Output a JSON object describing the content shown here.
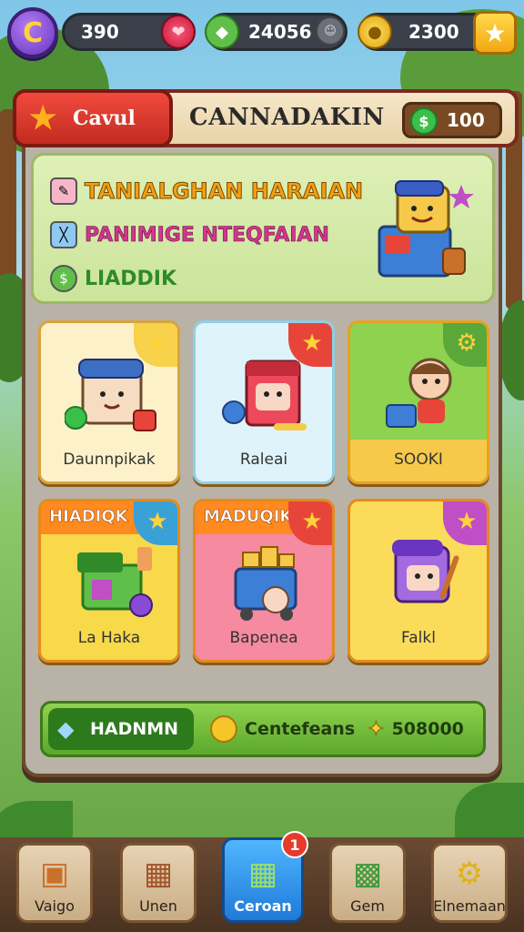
{
  "hud": {
    "avatar_glyph": "C",
    "lives_value": "390",
    "gems_value": "24056",
    "coins_value": "2300",
    "lives_icon": "heart-icon",
    "gems_icon": "gem-icon",
    "coins_icon": "coin-stack-icon",
    "star_icon": "star-icon"
  },
  "panel": {
    "ribbon_label": "Cavul",
    "title": "CANNADAKIN",
    "coin_value": "100",
    "coin_icon": "dollar-coin-icon"
  },
  "tasks": [
    {
      "label": "TANIALGHAN HARAIAN",
      "icon": "pencil-icon",
      "color": "#f2a012"
    },
    {
      "label": "PANIMIGE NTEQFAIAN",
      "icon": "ruler-icon",
      "color": "#d43590"
    },
    {
      "label": "LIADDIK",
      "icon": "dollar-coin-icon",
      "color": "#2f8a2a"
    }
  ],
  "cards": [
    {
      "label": "Daunnpikak",
      "header": "",
      "bg": "#fdf1c9",
      "tag_color": "#f7d24a",
      "tag_icon": "star-icon",
      "border": "#d9a43a"
    },
    {
      "label": "Raleai",
      "header": "",
      "bg": "#dff3fb",
      "tag_color": "#e8453a",
      "tag_icon": "star-icon",
      "border": "#8fcfe6"
    },
    {
      "label": "SOOKI",
      "header": "",
      "bg": "#8ed24f",
      "tag_color": "#5aa83a",
      "tag_icon": "gear-icon",
      "border": "#e7a21c"
    },
    {
      "label": "La Haka",
      "header": "HIADIQK",
      "bg": "#f7d94a",
      "tag_color": "#3aa1d6",
      "tag_icon": "star-icon",
      "border": "#e48a1c"
    },
    {
      "label": "Bapenea",
      "header": "MADUQIK",
      "bg": "#f58aa0",
      "tag_color": "#e8453a",
      "tag_icon": "star-icon",
      "border": "#e48a1c"
    },
    {
      "label": "Falkl",
      "header": "",
      "bg": "#fbdc5a",
      "tag_color": "#c04ec4",
      "tag_icon": "star-icon",
      "border": "#e48a1c"
    }
  ],
  "strip": {
    "left_label": "HADNMN",
    "mid_label": "Centefeans",
    "right_value": "508000"
  },
  "nav": [
    {
      "label": "Vaigo",
      "icon": "chest-icon",
      "active": false,
      "badge": ""
    },
    {
      "label": "Unen",
      "icon": "backpack-icon",
      "active": false,
      "badge": ""
    },
    {
      "label": "Ceroan",
      "icon": "map-icon",
      "active": true,
      "badge": "1"
    },
    {
      "label": "Gem",
      "icon": "armchair-icon",
      "active": false,
      "badge": ""
    },
    {
      "label": "Elnemaan",
      "icon": "gear-icon",
      "active": false,
      "badge": ""
    }
  ]
}
